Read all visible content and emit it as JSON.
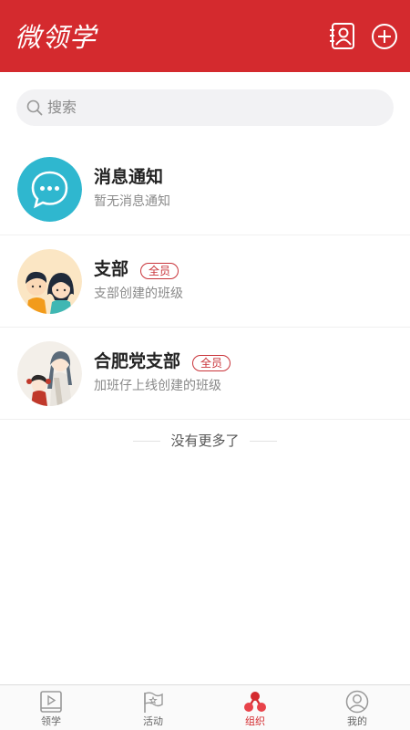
{
  "header": {
    "logo_text": "微领学",
    "icons": [
      "contacts-icon",
      "add-circle-icon"
    ],
    "background_color": "#d42a2e"
  },
  "search": {
    "placeholder": "搜索"
  },
  "conversations": [
    {
      "title": "消息通知",
      "subtitle": "暂无消息通知",
      "badge": null,
      "avatar": "message-bubble-icon"
    },
    {
      "title": "支部",
      "subtitle": "支部创建的班级",
      "badge": "全员",
      "avatar": "cartoon-couple-avatar"
    },
    {
      "title": "合肥党支部",
      "subtitle": "加班仔上线创建的班级",
      "badge": "全员",
      "avatar": "anime-characters-avatar"
    }
  ],
  "end_of_list": "没有更多了",
  "tabbar": {
    "tabs": [
      {
        "label": "领学",
        "icon": "video-play-icon",
        "active": false
      },
      {
        "label": "活动",
        "icon": "flag-icon",
        "active": false
      },
      {
        "label": "组织",
        "icon": "organization-icon",
        "active": true
      },
      {
        "label": "我的",
        "icon": "person-icon",
        "active": false
      }
    ],
    "active_color": "#d42a2e"
  }
}
